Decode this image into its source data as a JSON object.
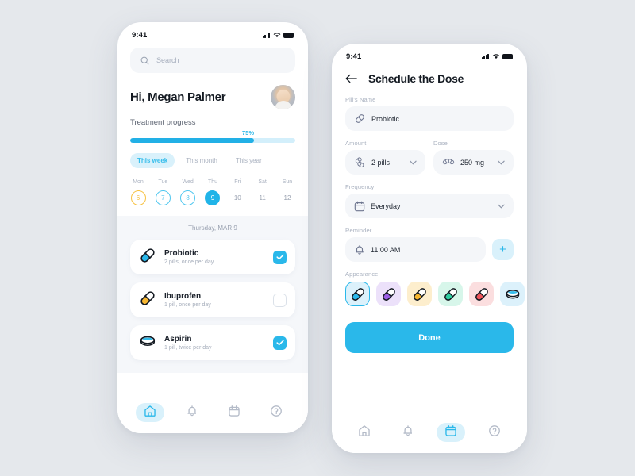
{
  "background_color": "#e5e8ec",
  "accent_color": "#2ab8ea",
  "home": {
    "status_bar": {
      "time": "9:41"
    },
    "search": {
      "placeholder": "Search",
      "icon": "search-icon"
    },
    "greeting": "Hi, Megan Palmer",
    "progress": {
      "label": "Treatment progress",
      "percent_text": "75%",
      "percent": 75
    },
    "filters": [
      {
        "label": "This week",
        "active": true
      },
      {
        "label": "This month",
        "active": false
      },
      {
        "label": "This year",
        "active": false
      }
    ],
    "week": [
      {
        "dow": "Mon",
        "num": "6",
        "state": "ring-amber"
      },
      {
        "dow": "Tue",
        "num": "7",
        "state": "ring-cyan"
      },
      {
        "dow": "Wed",
        "num": "8",
        "state": "ring-cyan"
      },
      {
        "dow": "Thu",
        "num": "9",
        "state": "filled"
      },
      {
        "dow": "Fri",
        "num": "10",
        "state": "plain"
      },
      {
        "dow": "Sat",
        "num": "11",
        "state": "plain"
      },
      {
        "dow": "Sun",
        "num": "12",
        "state": "plain"
      }
    ],
    "date_heading": "Thursday, MAR 9",
    "medications": [
      {
        "name": "Probiotic",
        "detail": "2 pills, once per day",
        "icon": "capsule-icon",
        "color": "#2ab8ea",
        "checked": true
      },
      {
        "name": "Ibuprofen",
        "detail": "1 pill, once per day",
        "icon": "capsule-icon",
        "color": "#f7b731",
        "checked": false
      },
      {
        "name": "Aspirin",
        "detail": "1 pill, twice per day",
        "icon": "tablet-icon",
        "color": "#2ab8ea",
        "checked": true
      }
    ],
    "nav": [
      {
        "icon": "home-icon",
        "active": true
      },
      {
        "icon": "bell-icon",
        "active": false
      },
      {
        "icon": "calendar-icon",
        "active": false
      },
      {
        "icon": "help-icon",
        "active": false
      }
    ]
  },
  "schedule": {
    "status_bar": {
      "time": "9:41"
    },
    "back_icon": "arrow-left-icon",
    "title": "Schedule the Dose",
    "pill_name": {
      "label": "Pill's Name",
      "value": "Probiotic",
      "icon": "capsule-icon"
    },
    "amount": {
      "label": "Amount",
      "value": "2 pills",
      "icon": "pills-icon"
    },
    "dose": {
      "label": "Dose",
      "value": "250 mg",
      "icon": "capsules-icon"
    },
    "frequency": {
      "label": "Frequency",
      "value": "Everyday",
      "icon": "calendar-icon"
    },
    "reminder": {
      "label": "Reminder",
      "value": "11:00 AM",
      "icon": "bell-icon",
      "add_label": "+"
    },
    "appearance": {
      "label": "Appearance",
      "options": [
        {
          "shape": "capsule",
          "color": "#2ab8ea",
          "bg": "#dcf1fb",
          "selected": true
        },
        {
          "shape": "capsule",
          "color": "#9b5de5",
          "bg": "#ece1fa",
          "selected": false
        },
        {
          "shape": "capsule",
          "color": "#f7b731",
          "bg": "#fdeecd",
          "selected": false
        },
        {
          "shape": "capsule",
          "color": "#2ecfa0",
          "bg": "#d7f6ea",
          "selected": false
        },
        {
          "shape": "capsule",
          "color": "#f0565c",
          "bg": "#fbdedf",
          "selected": false
        },
        {
          "shape": "tablet",
          "color": "#2ab8ea",
          "bg": "#dcf1fb",
          "selected": false
        }
      ]
    },
    "done_label": "Done",
    "nav": [
      {
        "icon": "home-icon",
        "active": false
      },
      {
        "icon": "bell-icon",
        "active": false
      },
      {
        "icon": "calendar-icon",
        "active": true
      },
      {
        "icon": "help-icon",
        "active": false
      }
    ]
  }
}
